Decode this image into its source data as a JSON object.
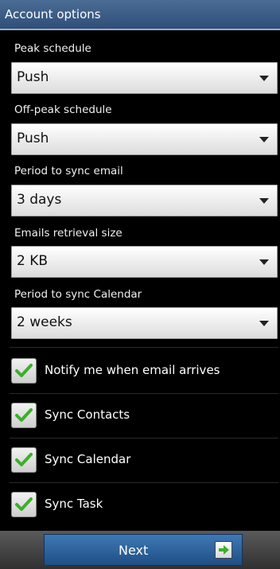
{
  "header": {
    "title": "Account options"
  },
  "settings": [
    {
      "label": "Peak schedule",
      "value": "Push"
    },
    {
      "label": "Off-peak schedule",
      "value": "Push"
    },
    {
      "label": "Period to sync email",
      "value": "3 days"
    },
    {
      "label": "Emails retrieval size",
      "value": "2 KB"
    },
    {
      "label": "Period to sync Calendar",
      "value": "2 weeks"
    }
  ],
  "checkboxes": [
    {
      "label": "Notify me when email arrives",
      "checked": true
    },
    {
      "label": "Sync Contacts",
      "checked": true
    },
    {
      "label": "Sync Calendar",
      "checked": true
    },
    {
      "label": "Sync Task",
      "checked": true
    }
  ],
  "footer": {
    "next_label": "Next"
  },
  "colors": {
    "header": "#3a5a86",
    "check": "#3cb02a",
    "button": "#2b63a0"
  },
  "icons": {
    "dropdown": "chevron-down-icon",
    "check": "check-icon",
    "next": "arrow-right-icon"
  }
}
